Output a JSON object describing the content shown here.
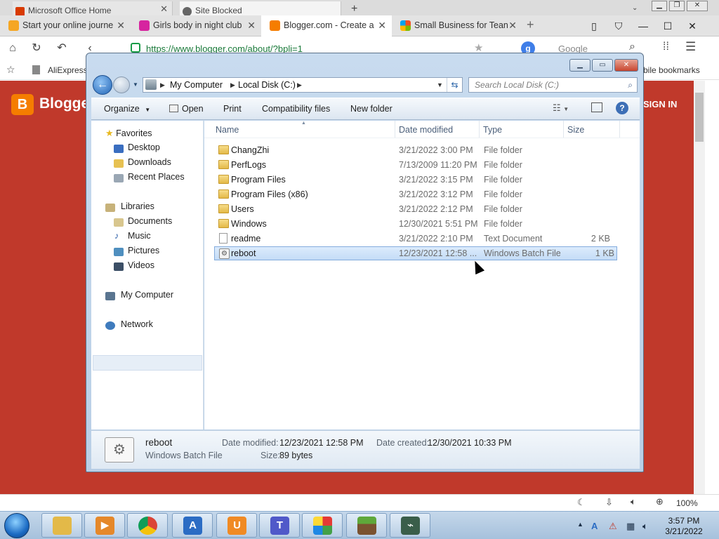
{
  "browser": {
    "top_tabs": [
      {
        "label": "Microsoft Office Home"
      },
      {
        "label": "Site Blocked"
      }
    ],
    "tabs": [
      {
        "label": "Start your online journe"
      },
      {
        "label": "Girls body in night club"
      },
      {
        "label": "Blogger.com - Create a"
      },
      {
        "label": "Small Business for Tean"
      }
    ],
    "address": "https://www.blogger.com/about/?bpli=1",
    "search_engine": "Google",
    "bookmarks": {
      "first": "AliExpress",
      "right": "bile bookmarks"
    }
  },
  "blogger": {
    "logo_letter": "B",
    "brand": "Blogger",
    "signin": "SIGN IN"
  },
  "explorer": {
    "breadcrumb": [
      "My Computer",
      "Local Disk (C:)"
    ],
    "search_placeholder": "Search Local Disk (C:)",
    "toolbar": {
      "organize": "Organize",
      "open": "Open",
      "print": "Print",
      "compatibility": "Compatibility files",
      "new_folder": "New folder"
    },
    "nav": {
      "favorites": "Favorites",
      "desktop": "Desktop",
      "downloads": "Downloads",
      "recent": "Recent Places",
      "libraries": "Libraries",
      "documents": "Documents",
      "music": "Music",
      "pictures": "Pictures",
      "videos": "Videos",
      "computer": "My Computer",
      "network": "Network"
    },
    "columns": {
      "name": "Name",
      "date": "Date modified",
      "type": "Type",
      "size": "Size"
    },
    "files": [
      {
        "name": "ChangZhi",
        "date": "3/21/2022 3:00 PM",
        "type": "File folder",
        "size": "",
        "kind": "folder"
      },
      {
        "name": "PerfLogs",
        "date": "7/13/2009 11:20 PM",
        "type": "File folder",
        "size": "",
        "kind": "folder"
      },
      {
        "name": "Program Files",
        "date": "3/21/2022 3:15 PM",
        "type": "File folder",
        "size": "",
        "kind": "folder"
      },
      {
        "name": "Program Files (x86)",
        "date": "3/21/2022 3:12 PM",
        "type": "File folder",
        "size": "",
        "kind": "folder"
      },
      {
        "name": "Users",
        "date": "3/21/2022 2:12 PM",
        "type": "File folder",
        "size": "",
        "kind": "folder"
      },
      {
        "name": "Windows",
        "date": "12/30/2021 5:51 PM",
        "type": "File folder",
        "size": "",
        "kind": "folder"
      },
      {
        "name": "readme",
        "date": "3/21/2022 2:10 PM",
        "type": "Text Document",
        "size": "2 KB",
        "kind": "doc"
      },
      {
        "name": "reboot",
        "date": "12/23/2021 12:58 ...",
        "type": "Windows Batch File",
        "size": "1 KB",
        "kind": "bat",
        "selected": true
      }
    ],
    "details": {
      "name": "reboot",
      "type": "Windows Batch File",
      "modified_label": "Date modified:",
      "modified": "12/23/2021 12:58 PM",
      "created_label": "Date created:",
      "created": "12/30/2021 10:33 PM",
      "size_label": "Size:",
      "size": "89 bytes"
    }
  },
  "statusbar": {
    "zoom": "100%"
  },
  "taskbar": {
    "time": "3:57 PM",
    "date": "3/21/2022"
  },
  "colors": {
    "blogger_red": "#c0392b",
    "blogger_orange": "#f57d00",
    "selection": "#c4dcf6",
    "taskbar": "#a6c1dc"
  }
}
